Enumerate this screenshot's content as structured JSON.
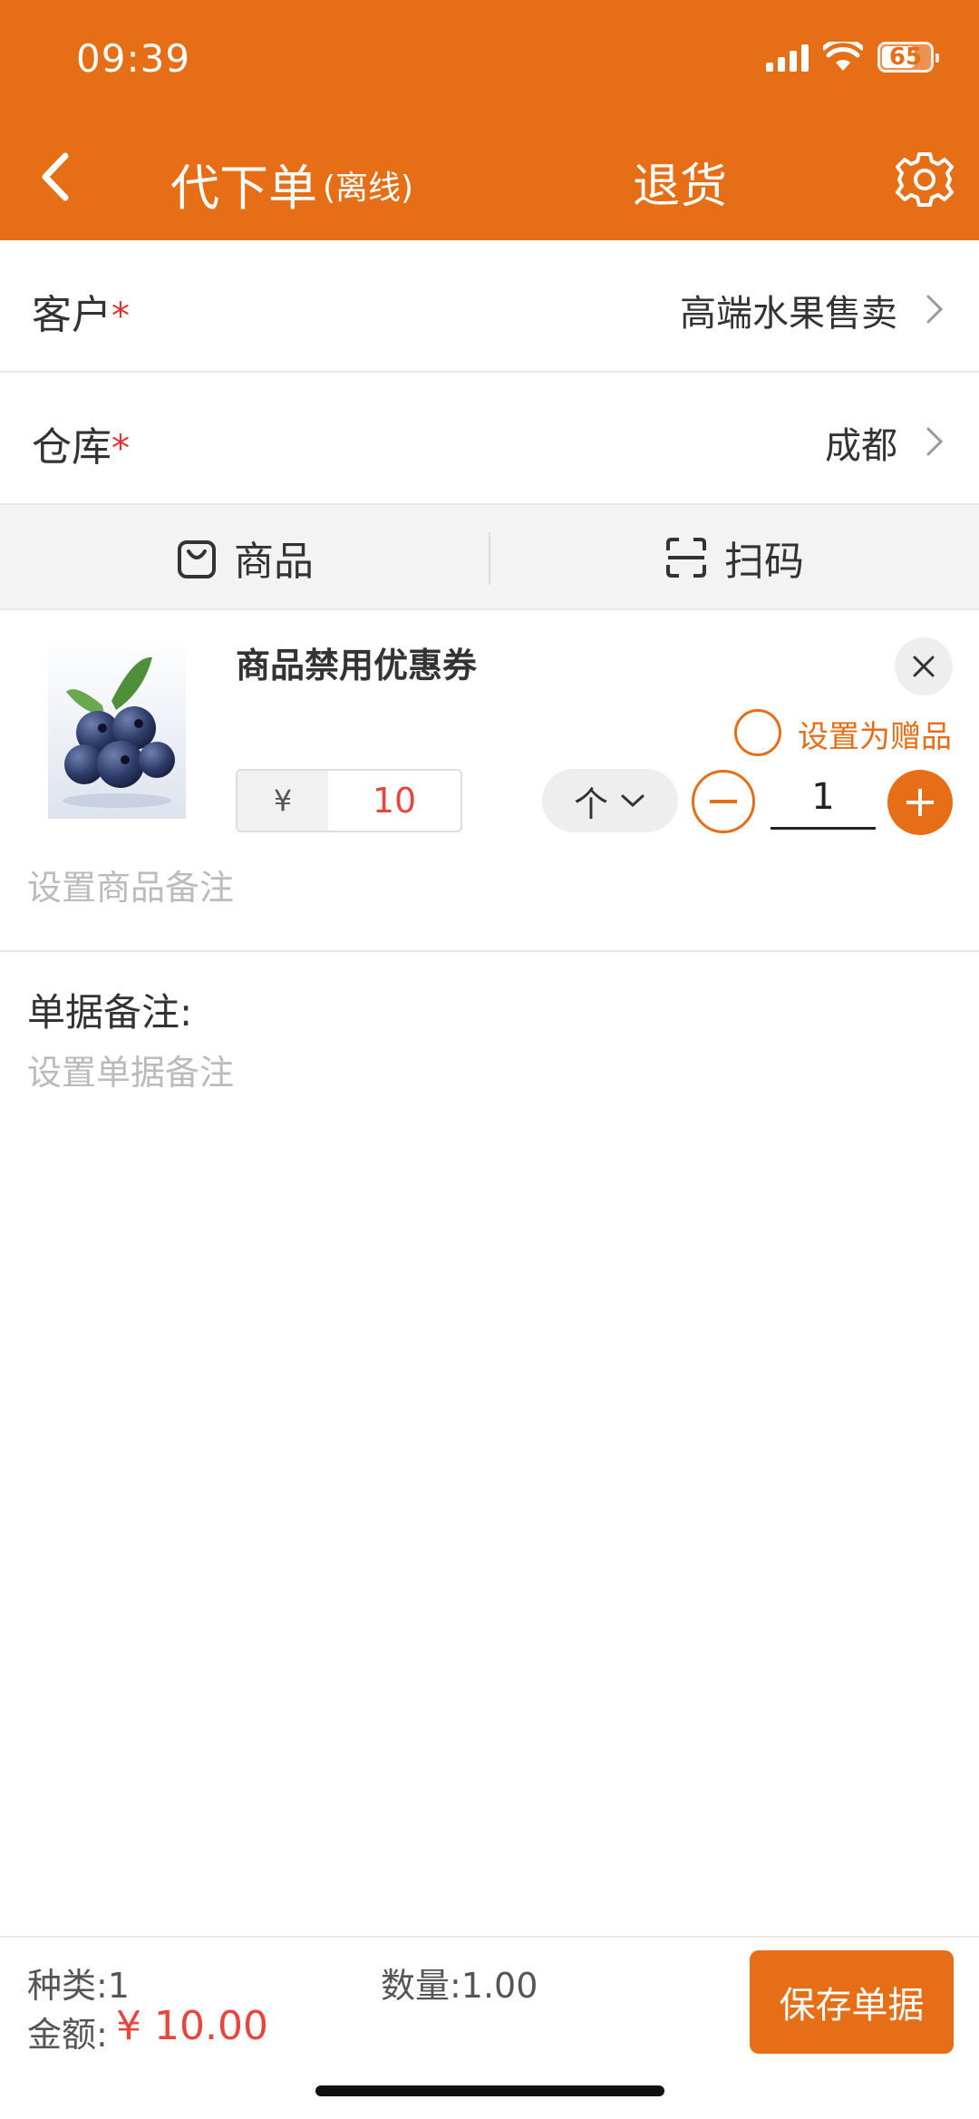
{
  "status_bar": {
    "time": "09:39",
    "battery": "65"
  },
  "header": {
    "title": "代下单",
    "subtitle": "(离线)",
    "action": "退货",
    "colors": {
      "brand": "#E56E17"
    }
  },
  "form": {
    "customer": {
      "label": "客户",
      "required_mark": "*",
      "value": "高端水果售卖"
    },
    "warehouse": {
      "label": "仓库",
      "required_mark": "*",
      "value": "成都"
    }
  },
  "tabs": [
    {
      "label": "商品",
      "icon": "shopping-bag-icon"
    },
    {
      "label": "扫码",
      "icon": "scan-icon"
    }
  ],
  "product": {
    "name": "商品禁用优惠券",
    "image": "blueberry-image",
    "gift_label": "设置为赠品",
    "currency": "¥",
    "price": "10",
    "unit": "个",
    "quantity": "1",
    "remark_placeholder": "设置商品备注"
  },
  "order_remark": {
    "label": "单据备注:",
    "placeholder": "设置单据备注"
  },
  "footer": {
    "kinds": "种类:1",
    "quantity": "数量:1.00",
    "amount_label": "金额:",
    "amount_value": "¥ 10.00",
    "save_label": "保存单据"
  }
}
